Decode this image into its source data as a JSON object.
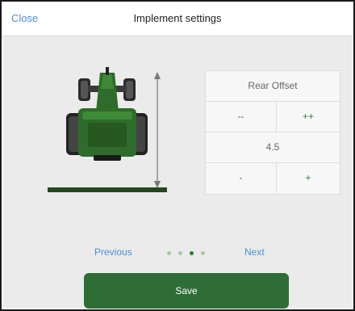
{
  "header": {
    "close_label": "Close",
    "title": "Implement settings"
  },
  "offset_panel": {
    "title": "Rear Offset",
    "big_decrement": "--",
    "big_increment": "++",
    "value": "4.5",
    "small_decrement": "-",
    "small_increment": "+"
  },
  "pager": {
    "previous_label": "Previous",
    "next_label": "Next",
    "pages": 4,
    "current_page": 3
  },
  "footer": {
    "save_label": "Save"
  },
  "colors": {
    "accent_blue": "#4a90d9",
    "brand_green": "#2e6e36",
    "tractor_green": "#2f6b2a"
  }
}
